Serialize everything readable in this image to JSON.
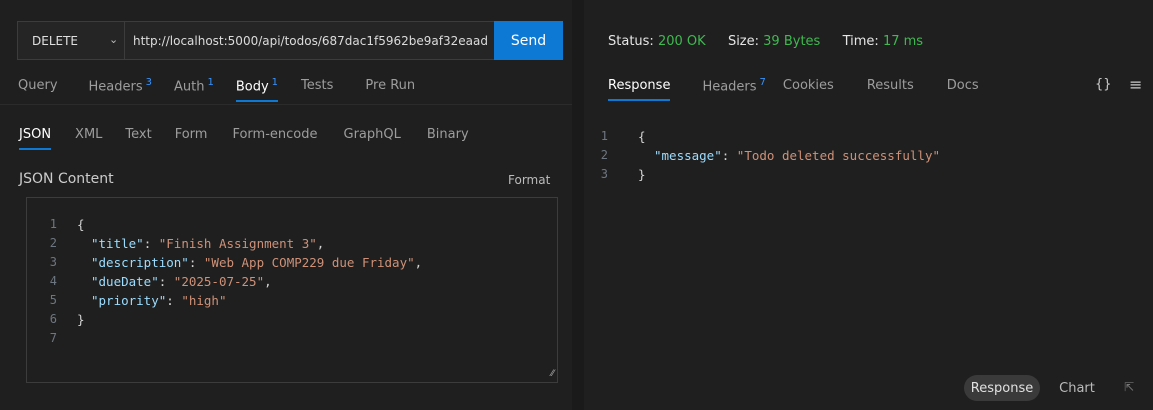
{
  "request": {
    "method": "DELETE",
    "url": "http://localhost:5000/api/todos/687dac1f5962be9af32eaad",
    "send_label": "Send",
    "tabs": [
      {
        "label": "Query",
        "badge": ""
      },
      {
        "label": "Headers",
        "badge": "3"
      },
      {
        "label": "Auth",
        "badge": "1"
      },
      {
        "label": "Body",
        "badge": "1"
      },
      {
        "label": "Tests",
        "badge": ""
      },
      {
        "label": "Pre Run",
        "badge": ""
      }
    ],
    "body_types": [
      "JSON",
      "XML",
      "Text",
      "Form",
      "Form-encode",
      "GraphQL",
      "Binary"
    ],
    "content_label": "JSON Content",
    "format_label": "Format",
    "code_lines": [
      {
        "n": "1",
        "text": "{"
      },
      {
        "n": "2",
        "key": "\"title\"",
        "value": "\"Finish Assignment 3\""
      },
      {
        "n": "3",
        "key": "\"description\"",
        "value": "\"Web App COMP229 due Friday\""
      },
      {
        "n": "4",
        "key": "\"dueDate\"",
        "value": "\"2025-07-25\""
      },
      {
        "n": "5",
        "key": "\"priority\"",
        "value": "\"high\""
      },
      {
        "n": "6",
        "text": "}"
      },
      {
        "n": "7",
        "text": ""
      }
    ]
  },
  "response": {
    "status_label": "Status:",
    "status_value": "200 OK",
    "size_label": "Size:",
    "size_value": "39 Bytes",
    "time_label": "Time:",
    "time_value": "17 ms",
    "tabs": [
      {
        "label": "Response",
        "badge": ""
      },
      {
        "label": "Headers",
        "badge": "7"
      },
      {
        "label": "Cookies",
        "badge": ""
      },
      {
        "label": "Results",
        "badge": ""
      },
      {
        "label": "Docs",
        "badge": ""
      }
    ],
    "braces_icon": "{}",
    "menu_icon": "≡",
    "code_lines": [
      {
        "n": "1",
        "text": "{"
      },
      {
        "n": "2",
        "key": "\"message\"",
        "value": "\"Todo deleted successfully\""
      },
      {
        "n": "3",
        "text": "}"
      }
    ],
    "bottom_response": "Response",
    "bottom_chart": "Chart"
  },
  "colors": {
    "accent": "#0e78d5",
    "status_green": "#3fb950",
    "badge_blue": "#3794ff"
  }
}
